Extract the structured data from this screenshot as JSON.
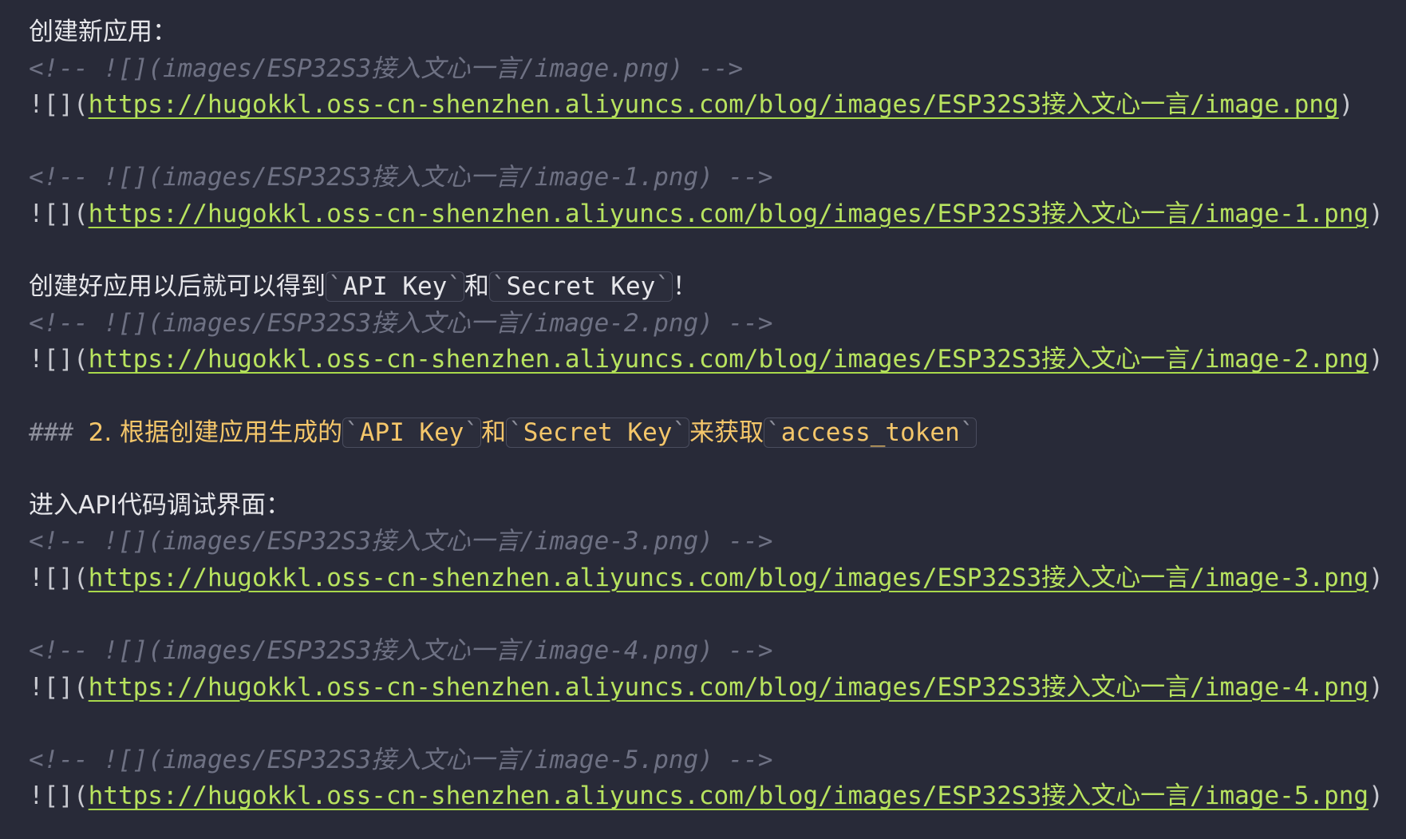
{
  "lines": {
    "l1": {
      "text": "创建新应用："
    },
    "l2": {
      "comment": "<!-- ![](images/ESP32S3接入文心一言/image.png) -->"
    },
    "l3": {
      "open": "![](",
      "url": "https://hugokkl.oss-cn-shenzhen.aliyuncs.com/blog/images/ESP32S3接入文心一言/image.png",
      "close": ")"
    },
    "l5": {
      "comment": "<!-- ![](images/ESP32S3接入文心一言/image-1.png) -->"
    },
    "l6": {
      "open": "![](",
      "url": "https://hugokkl.oss-cn-shenzhen.aliyuncs.com/blog/images/ESP32S3接入文心一言/image-1.png",
      "close": ")"
    },
    "l8": {
      "t1": "创建好应用以后就可以得到",
      "c1": "API Key",
      "t2": "和",
      "c2": "Secret Key",
      "t3": "！"
    },
    "l9": {
      "comment": "<!-- ![](images/ESP32S3接入文心一言/image-2.png) -->"
    },
    "l10": {
      "open": "![](",
      "url": "https://hugokkl.oss-cn-shenzhen.aliyuncs.com/blog/images/ESP32S3接入文心一言/image-2.png",
      "close": ")"
    },
    "l12": {
      "hash": "###",
      "t1": "2. 根据创建应用生成的",
      "c1": "API Key",
      "t2": "和",
      "c2": "Secret Key",
      "t3": "来获取",
      "c3": "access_token"
    },
    "l14": {
      "text": "进入API代码调试界面："
    },
    "l15": {
      "comment": "<!-- ![](images/ESP32S3接入文心一言/image-3.png) -->"
    },
    "l16": {
      "open": "![](",
      "url": "https://hugokkl.oss-cn-shenzhen.aliyuncs.com/blog/images/ESP32S3接入文心一言/image-3.png",
      "close": ")"
    },
    "l18": {
      "comment": "<!-- ![](images/ESP32S3接入文心一言/image-4.png) -->"
    },
    "l19": {
      "open": "![](",
      "url": "https://hugokkl.oss-cn-shenzhen.aliyuncs.com/blog/images/ESP32S3接入文心一言/image-4.png",
      "close": ")"
    },
    "l21": {
      "comment": "<!-- ![](images/ESP32S3接入文心一言/image-5.png) -->"
    },
    "l22": {
      "open": "![](",
      "url": "https://hugokkl.oss-cn-shenzhen.aliyuncs.com/blog/images/ESP32S3接入文心一言/image-5.png",
      "close": ")"
    }
  },
  "backtick": "`",
  "colors": {
    "background": "#282a38",
    "text": "#e6e6ea",
    "comment": "#6e7183",
    "link": "#b8e35f",
    "heading": "#f4c66a"
  }
}
